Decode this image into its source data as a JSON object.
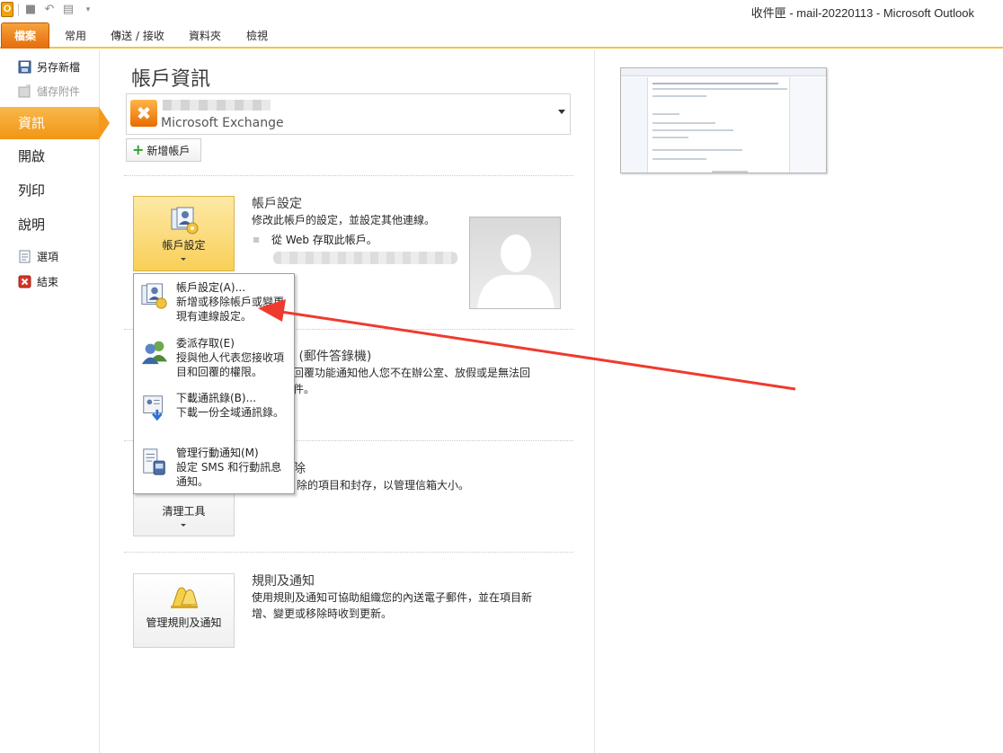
{
  "window": {
    "title": "收件匣 - mail-20220113 - Microsoft Outlook"
  },
  "ribbon": {
    "tabs": [
      {
        "label": "檔案"
      },
      {
        "label": "常用"
      },
      {
        "label": "傳送 / 接收"
      },
      {
        "label": "資料夾"
      },
      {
        "label": "檢視"
      }
    ]
  },
  "nav": {
    "commands": [
      {
        "label": "另存新檔",
        "enabled": true,
        "icon": "save-as-icon"
      },
      {
        "label": "儲存附件",
        "enabled": false,
        "icon": "save-attachments-icon"
      }
    ],
    "items": [
      {
        "label": "資訊",
        "active": true
      },
      {
        "label": "開啟",
        "active": false
      },
      {
        "label": "列印",
        "active": false
      },
      {
        "label": "說明",
        "active": false
      }
    ],
    "bottom_commands": [
      {
        "label": "選項",
        "icon": "options-icon"
      },
      {
        "label": "結束",
        "icon": "exit-icon"
      }
    ]
  },
  "page": {
    "title": "帳戶資訊",
    "account_type": "Microsoft Exchange",
    "add_account": "新增帳戶"
  },
  "sections": {
    "account_settings": {
      "button": "帳戶設定",
      "title": "帳戶設定",
      "desc": "修改此帳戶的設定，並設定其他連線。",
      "web_access": "從 Web 存取此帳戶。"
    },
    "auto_reply": {
      "title_tail": "覆 (郵件答錄機)",
      "desc_line1": "動回覆功能通知他人您不在辦公室、放假或是無法回",
      "desc_line2": "郵件。"
    },
    "cleanup": {
      "button": "清理工具",
      "title_tail": "除",
      "desc_tail": "除的項目和封存，以管理信箱大小。"
    },
    "rules": {
      "button": "管理規則及通知",
      "title": "規則及通知",
      "desc_line1": "使用規則及通知可協助組織您的內送電子郵件，並在項目新",
      "desc_line2": "增、變更或移除時收到更新。"
    }
  },
  "menu": {
    "items": [
      {
        "title": "帳戶設定(A)...",
        "desc": "新增或移除帳戶或變更現有連線設定。",
        "icon": "account-settings-icon"
      },
      {
        "title": "委派存取(E)",
        "desc": "授與他人代表您接收項目和回覆的權限。",
        "icon": "delegate-access-icon"
      },
      {
        "title": "下載通訊錄(B)...",
        "desc": "下載一份全域通訊錄。",
        "icon": "address-book-icon"
      },
      {
        "title": "管理行動通知(M)",
        "desc": "設定 SMS 和行動訊息通知。",
        "icon": "mobile-notify-icon"
      }
    ]
  },
  "colors": {
    "accent": "#f29614",
    "file_tab": "#e46c0a",
    "annotation_arrow": "#f03a2e"
  }
}
